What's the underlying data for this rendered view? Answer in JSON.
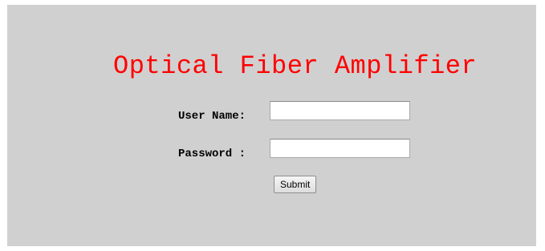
{
  "login": {
    "title": "Optical Fiber Amplifier",
    "username_label": "User Name:",
    "username_value": "",
    "password_label": "Password :",
    "password_value": "",
    "submit_label": "Submit"
  },
  "colors": {
    "background": "#d0d0d0",
    "title": "#ff0000"
  }
}
